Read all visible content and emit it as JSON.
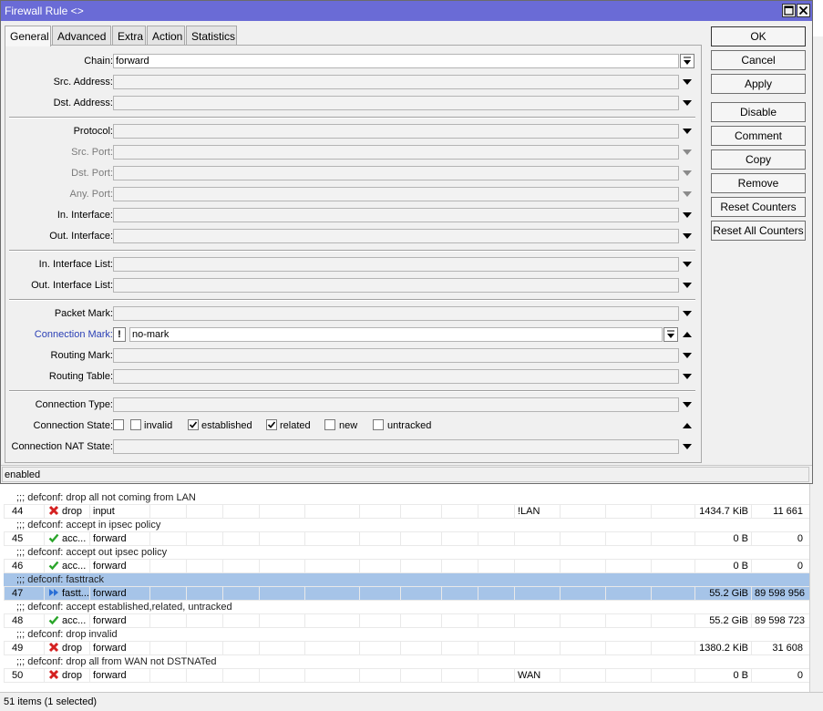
{
  "window": {
    "title": "Firewall Rule <>"
  },
  "tabs": [
    {
      "label": "General"
    },
    {
      "label": "Advanced"
    },
    {
      "label": "Extra"
    },
    {
      "label": "Action"
    },
    {
      "label": "Statistics"
    }
  ],
  "fields": {
    "chain": {
      "label": "Chain:",
      "value": "forward"
    },
    "src_address": {
      "label": "Src. Address:",
      "value": ""
    },
    "dst_address": {
      "label": "Dst. Address:",
      "value": ""
    },
    "protocol": {
      "label": "Protocol:",
      "value": ""
    },
    "src_port": {
      "label": "Src. Port:",
      "value": ""
    },
    "dst_port": {
      "label": "Dst. Port:",
      "value": ""
    },
    "any_port": {
      "label": "Any. Port:",
      "value": ""
    },
    "in_interface": {
      "label": "In. Interface:",
      "value": ""
    },
    "out_interface": {
      "label": "Out. Interface:",
      "value": ""
    },
    "in_interface_list": {
      "label": "In. Interface List:",
      "value": ""
    },
    "out_interface_list": {
      "label": "Out. Interface List:",
      "value": ""
    },
    "packet_mark": {
      "label": "Packet Mark:",
      "value": ""
    },
    "connection_mark": {
      "label": "Connection Mark:",
      "negate": "!",
      "value": "no-mark"
    },
    "routing_mark": {
      "label": "Routing Mark:",
      "value": ""
    },
    "routing_table": {
      "label": "Routing Table:",
      "value": ""
    },
    "connection_type": {
      "label": "Connection Type:",
      "value": ""
    },
    "connection_state": {
      "label": "Connection State:",
      "options": [
        {
          "label": "invalid",
          "checked": false
        },
        {
          "label": "established",
          "checked": true
        },
        {
          "label": "related",
          "checked": true
        },
        {
          "label": "new",
          "checked": false
        },
        {
          "label": "untracked",
          "checked": false
        }
      ]
    },
    "connection_nat_state": {
      "label": "Connection NAT State:",
      "value": ""
    }
  },
  "buttons": {
    "ok": "OK",
    "cancel": "Cancel",
    "apply": "Apply",
    "disable": "Disable",
    "comment": "Comment",
    "copy": "Copy",
    "remove": "Remove",
    "reset_counters": "Reset Counters",
    "reset_all_counters": "Reset All Counters"
  },
  "dialog_status": "enabled",
  "rule_list": {
    "rows": [
      {
        "kind": "comment",
        "text": ";;; defconf: drop all not coming from LAN"
      },
      {
        "kind": "rule",
        "num": "44",
        "action_icon": "drop-icon",
        "action": "drop",
        "chain": "input",
        "iface": "!LAN",
        "bytes": "1434.7 KiB",
        "packets": "11 661"
      },
      {
        "kind": "comment",
        "text": ";;; defconf: accept in ipsec policy"
      },
      {
        "kind": "rule",
        "num": "45",
        "action_icon": "accept-icon",
        "action": "acc...",
        "chain": "forward",
        "iface": "",
        "bytes": "0 B",
        "packets": "0"
      },
      {
        "kind": "comment",
        "text": ";;; defconf: accept out ipsec policy"
      },
      {
        "kind": "rule",
        "num": "46",
        "action_icon": "accept-icon",
        "action": "acc...",
        "chain": "forward",
        "iface": "",
        "bytes": "0 B",
        "packets": "0"
      },
      {
        "kind": "comment",
        "text": ";;; defconf: fasttrack",
        "selected": true
      },
      {
        "kind": "rule",
        "num": "47",
        "action_icon": "fasttrack-icon",
        "action": "fastt...",
        "chain": "forward",
        "iface": "",
        "bytes": "55.2 GiB",
        "packets": "89 598 956",
        "selected": true
      },
      {
        "kind": "comment",
        "text": ";;; defconf: accept established,related, untracked"
      },
      {
        "kind": "rule",
        "num": "48",
        "action_icon": "accept-icon",
        "action": "acc...",
        "chain": "forward",
        "iface": "",
        "bytes": "55.2 GiB",
        "packets": "89 598 723"
      },
      {
        "kind": "comment",
        "text": ";;; defconf: drop invalid"
      },
      {
        "kind": "rule",
        "num": "49",
        "action_icon": "drop-icon",
        "action": "drop",
        "chain": "forward",
        "iface": "",
        "bytes": "1380.2 KiB",
        "packets": "31 608"
      },
      {
        "kind": "comment",
        "text": ";;; defconf:  drop all from WAN not DSTNATed"
      },
      {
        "kind": "rule",
        "num": "50",
        "action_icon": "drop-icon",
        "action": "drop",
        "chain": "forward",
        "iface": "WAN",
        "bytes": "0 B",
        "packets": "0"
      }
    ],
    "status": "51 items (1 selected)"
  },
  "colors": {
    "titlebar": "#6a6bd6",
    "selected_row": "#a6c4e8",
    "drop": "#d42020",
    "accept": "#2aa52a",
    "fasttrack": "#2a6fd6",
    "connection_mark_label": "#2a3fb5"
  }
}
